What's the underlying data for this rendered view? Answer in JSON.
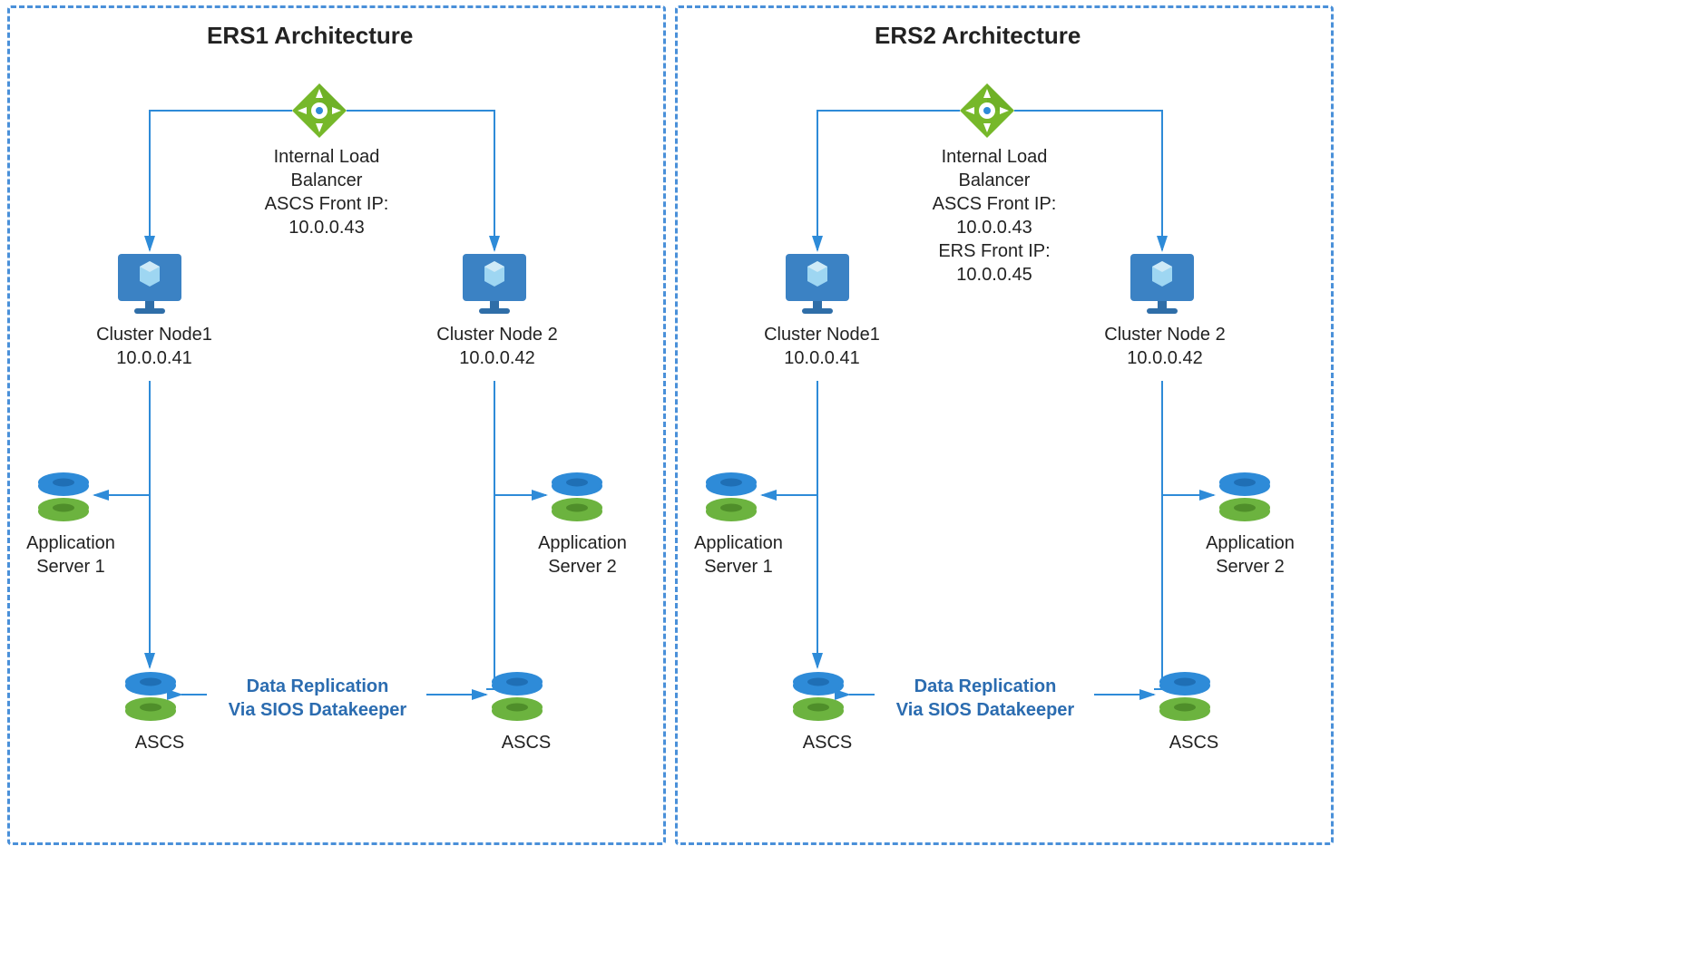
{
  "left": {
    "title": "ERS1 Architecture",
    "lb": {
      "l1": "Internal Load",
      "l2": "Balancer",
      "l3": "ASCS Front IP:",
      "l4": "10.0.0.43",
      "l5": "",
      "l6": ""
    },
    "node1": {
      "name": "Cluster Node1",
      "ip": "10.0.0.41"
    },
    "node2": {
      "name": "Cluster Node 2",
      "ip": "10.0.0.42"
    },
    "app1": {
      "l1": "Application",
      "l2": "Server 1"
    },
    "app2": {
      "l1": "Application",
      "l2": "Server 2"
    },
    "ascs1": "ASCS",
    "ascs2": "ASCS",
    "repl": {
      "l1": "Data Replication",
      "l2": "Via SIOS Datakeeper"
    }
  },
  "right": {
    "title": "ERS2 Architecture",
    "lb": {
      "l1": "Internal Load",
      "l2": "Balancer",
      "l3": "ASCS Front IP:",
      "l4": "10.0.0.43",
      "l5": "ERS Front IP:",
      "l6": "10.0.0.45"
    },
    "node1": {
      "name": "Cluster Node1",
      "ip": "10.0.0.41"
    },
    "node2": {
      "name": "Cluster Node 2",
      "ip": "10.0.0.42"
    },
    "app1": {
      "l1": "Application",
      "l2": "Server 1"
    },
    "app2": {
      "l1": "Application",
      "l2": "Server 2"
    },
    "ascs1": "ASCS",
    "ascs2": "ASCS",
    "repl": {
      "l1": "Data Replication",
      "l2": "Via SIOS Datakeeper"
    }
  }
}
